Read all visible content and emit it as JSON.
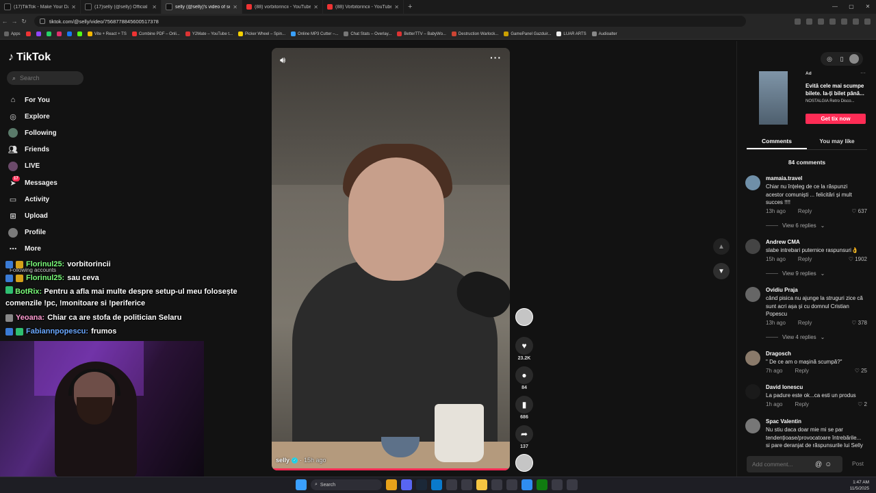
{
  "browser": {
    "tabs": [
      {
        "title": "(17)TikTok - Make Your Day",
        "icon": "tiktok-icon",
        "active": false
      },
      {
        "title": "(17)selly (@selly) Official | TikTok",
        "icon": "tiktok-icon",
        "active": false
      },
      {
        "title": "selly (@selly)'s video of selly",
        "icon": "tiktok-icon",
        "active": true
      },
      {
        "title": "(88) vorbitorincii - YouTube",
        "icon": "youtube-icon",
        "active": false
      },
      {
        "title": "(88) Vorbitorincii - YouTube",
        "icon": "youtube-icon",
        "active": false
      }
    ],
    "url": "tiktok.com/@selly/video/7568778845600517378",
    "bookmarks": [
      "Apps",
      "Vite + React + TS",
      "Combine PDF – Onli...",
      "Y2Mate – YouTube t...",
      "Picker Wheel – Spin...",
      "Online MP3 Cutter –...",
      "Chat Stats – Overlay...",
      "BetterTTV – BabyWo...",
      "Destruction Warlock...",
      "GamePanel Gazduir...",
      "LUAR ARTS",
      "Audioalter"
    ]
  },
  "tiktok": {
    "logo": "TikTok",
    "search_placeholder": "Search",
    "nav": [
      {
        "label": "For You",
        "icon": "home-icon"
      },
      {
        "label": "Explore",
        "icon": "compass-icon"
      },
      {
        "label": "Following",
        "icon": "avatar"
      },
      {
        "label": "Friends",
        "icon": "friends-icon"
      },
      {
        "label": "LIVE",
        "icon": "avatar"
      },
      {
        "label": "Messages",
        "icon": "send-icon",
        "badge": "17"
      },
      {
        "label": "Activity",
        "icon": "chat-icon"
      },
      {
        "label": "Upload",
        "icon": "upload-icon"
      },
      {
        "label": "Profile",
        "icon": "avatar"
      },
      {
        "label": "More",
        "icon": "more-icon"
      }
    ],
    "following_accounts_label": "Following accounts"
  },
  "stream_chat": [
    {
      "user": "Florinul25:",
      "message": "vorbitorincii",
      "color": "#7bff7b"
    },
    {
      "user": "Florinul25:",
      "message": "sau ceva",
      "color": "#7bff7b"
    },
    {
      "user": "BotRix:",
      "message": "Pentru a afla mai multe despre setup-ul meu folosește comenzile !pc, !monitoare si !periferice",
      "color": "#7bff7b"
    },
    {
      "user": "Yeoana:",
      "message": "Chiar ca are stofa de politician Selaru",
      "color": "#ff9bd1"
    },
    {
      "user": "Fabiannpopescu:",
      "message": "frumos",
      "color": "#6aa8ff"
    }
  ],
  "video": {
    "author": "selly",
    "time_ago": "15h ago",
    "actions": {
      "likes": "23.2K",
      "comments": "84",
      "saves": "686",
      "shares": "137"
    }
  },
  "ad": {
    "label": "Ad",
    "title": "Evită cele mai scumpe bilete. Ia-ți bilet până...",
    "brand": "NOSTALGIA Retro Disco...",
    "cta": "Get tix now"
  },
  "panel_tabs": [
    "Comments",
    "You may like"
  ],
  "comments_count": "84 comments",
  "comments": [
    {
      "user": "mamaia.travel",
      "text": "Chiar nu înțeleg de ce la răspunzi acestor comuniști ... felicitări și mult succes !!!!",
      "time": "13h ago",
      "reply": "Reply",
      "likes": "637",
      "view_replies": "View 6 replies"
    },
    {
      "user": "Andrew CMA",
      "text": "slabe intrebari puternice raspunsuri👌",
      "time": "15h ago",
      "reply": "Reply",
      "likes": "1902",
      "view_replies": "View 9 replies"
    },
    {
      "user": "Ovidiu Praja",
      "text": "când pisica nu ajunge la struguri zice că sunt acri așa și cu domnul Cristian Popescu",
      "time": "13h ago",
      "reply": "Reply",
      "likes": "378",
      "view_replies": "View 4 replies"
    },
    {
      "user": "Dragosch",
      "text": "\" De ce am o mașină scumpă?\"",
      "time": "7h ago",
      "reply": "Reply",
      "likes": "25"
    },
    {
      "user": "David Ionescu",
      "text": "La padure este ok...ca esti un produs",
      "time": "1h ago",
      "reply": "Reply",
      "likes": "2"
    },
    {
      "user": "Spac Valentin",
      "text": "Nu stiu daca doar mie mi se par tendențioase/provocatoare întrebările... si pare deranjat de răspunsurile lui Selly"
    }
  ],
  "add_comment_placeholder": "Add comment...",
  "post_label": "Post",
  "taskbar": {
    "search": "Search",
    "time": "1:47 AM",
    "date": "11/5/2025"
  }
}
